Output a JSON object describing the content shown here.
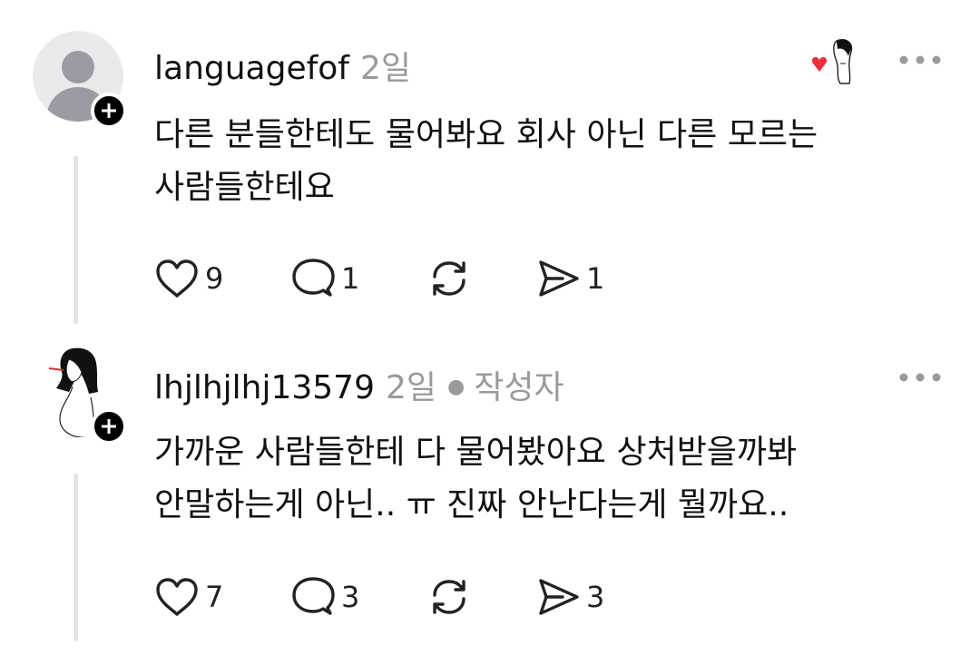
{
  "comments": [
    {
      "username": "languagefof",
      "time": "2일",
      "author_tag": "",
      "text_line1": "다른 분들한테도 물어봐요 회사 아닌 다른 모르는",
      "text_line2": "사람들한테요",
      "likes": "9",
      "replies": "1",
      "reposts": "",
      "shares": "1"
    },
    {
      "username": "lhjlhjlhj13579",
      "time": "2일",
      "author_tag": "작성자",
      "text_line1": "가까운 사람들한테 다 물어봤아요 상처받을까봐",
      "text_line2": "안말하는게 아닌.. ㅠ 진짜 안난다는게 뭘까요..",
      "likes": "7",
      "replies": "3",
      "reposts": "",
      "shares": "3"
    }
  ],
  "icons": {
    "like": "heart-icon",
    "reply": "speech-bubble-icon",
    "repost": "repost-icon",
    "share": "send-icon",
    "more": "more-dots-icon",
    "follow": "plus-icon"
  },
  "colors": {
    "heart_red": "#e8313a",
    "meta_gray": "#9a9a9a",
    "thread_line": "#e3e3e3"
  }
}
